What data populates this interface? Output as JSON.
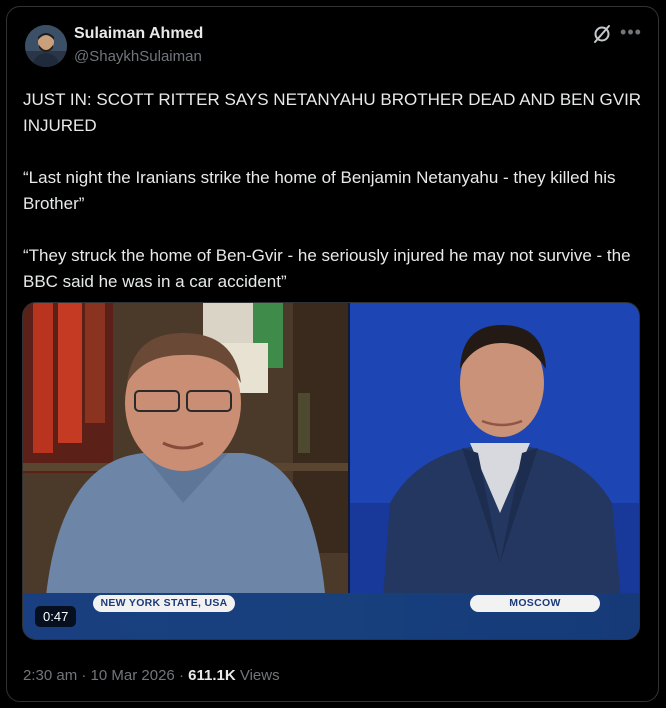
{
  "author": {
    "name": "Sulaiman Ahmed",
    "handle": "@ShaykhSulaiman"
  },
  "icons": {
    "grok": "grok-icon",
    "more": "more-icon"
  },
  "tweet": {
    "paragraphs": [
      "JUST IN: SCOTT RITTER SAYS NETANYAHU BROTHER DEAD AND BEN GVIR INJURED",
      "“Last night the Iranians strike the home of Benjamin Netanyahu - they killed his Brother”",
      "“They struck the home of Ben-Gvir - he seriously injured he may not survive - the BBC said he was in a car accident”"
    ]
  },
  "media": {
    "left_location": "NEW YORK STATE, USA",
    "right_location": "MOSCOW",
    "duration": "0:47"
  },
  "meta": {
    "time": "2:30 am",
    "separator": " · ",
    "date": "10 Mar 2026",
    "views_count": "611.1K",
    "views_label": "Views"
  },
  "colors": {
    "background": "#000000",
    "text": "#e7e9ea",
    "muted": "#71767b",
    "border": "#2f3336",
    "news_bar": "#17407d"
  }
}
